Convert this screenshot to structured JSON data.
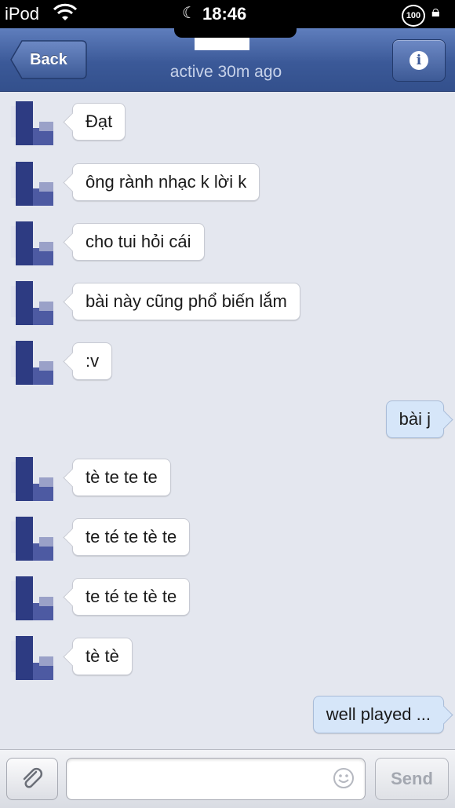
{
  "status_bar": {
    "carrier": "iPod",
    "time": "18:46",
    "battery": "100",
    "icons": [
      "wifi-icon",
      "moon-icon",
      "lock-rotation-icon"
    ]
  },
  "nav": {
    "back_label": "Back",
    "subtitle": "active 30m ago",
    "info_icon": "info-icon"
  },
  "messages": [
    {
      "side": "in",
      "text": "Đạt"
    },
    {
      "side": "in",
      "text": "ông rành nhạc k lời k"
    },
    {
      "side": "in",
      "text": "cho tui hỏi cái"
    },
    {
      "side": "in",
      "text": "bài này cũng phổ biến lắm"
    },
    {
      "side": "in",
      "text": ":v"
    },
    {
      "side": "out",
      "text": "bài j"
    },
    {
      "side": "in",
      "text": "tè te te te"
    },
    {
      "side": "in",
      "text": "te té te tè te"
    },
    {
      "side": "in",
      "text": "te té te tè te"
    },
    {
      "side": "in",
      "text": "tè tè"
    },
    {
      "side": "out",
      "text": "well played ..."
    }
  ],
  "composer": {
    "input_value": "",
    "input_placeholder": "",
    "send_label": "Send"
  },
  "colors": {
    "nav_blue": "#3b5998",
    "incoming_bubble": "#ffffff",
    "outgoing_bubble": "#d6e6f9",
    "background": "#e4e7ef"
  }
}
